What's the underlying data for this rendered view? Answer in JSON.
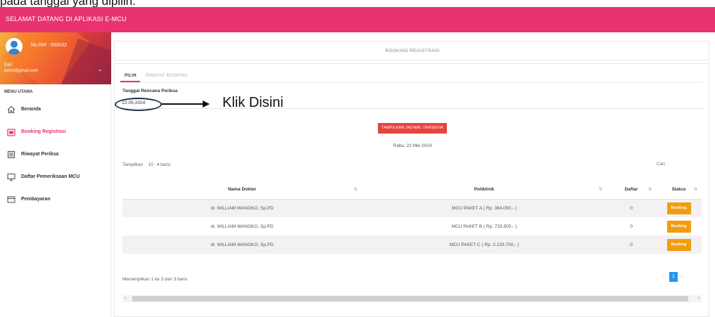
{
  "caption": "pada tanggal yang dipilih.",
  "app": {
    "title": "SELAMAT DATANG DI APLIKASI E-MCU",
    "brand_color": "#e9336f"
  },
  "profile": {
    "rm": "No.RM : 000032",
    "name": "D&F",
    "email": "bshst@gmail.com"
  },
  "sidebar": {
    "menu_title": "MENU UTAMA",
    "items": [
      {
        "label": "Beranda",
        "icon": "home-icon",
        "active": false
      },
      {
        "label": "Booking Registrasi",
        "icon": "booking-icon",
        "active": true
      },
      {
        "label": "Riwayat Periksa",
        "icon": "history-icon",
        "active": false
      },
      {
        "label": "Daftar Pemeriksaan MCU",
        "icon": "monitor-icon",
        "active": false
      },
      {
        "label": "Pembayaran",
        "icon": "payment-icon",
        "active": false
      }
    ]
  },
  "page": {
    "header": "BOOKING REGISTRASI",
    "tabs": [
      {
        "label": "PILIH",
        "active": true
      },
      {
        "label": "RIWAYAT BOOKING",
        "active": false
      }
    ],
    "date_label": "Tanggal Rencana Periksa",
    "date_value": "22-05-2024",
    "show_button": "TAMPILKAN JADWAL TERSEDIA",
    "date_text": "Rabu, 22 Mei 2024",
    "show_entries": {
      "prefix": "Tampilkan",
      "value": "10",
      "suffix": "baris"
    },
    "search_label": "Cari :"
  },
  "table": {
    "headers": [
      "Nama Dokter",
      "Poliklinik",
      "Daftar",
      "Status"
    ],
    "rows": [
      {
        "doctor": "dr. WILLIAM WANGKO, Sp.PD",
        "poli": "MCU PAKET A ( Rp. 364.000,- )",
        "daftar": "0",
        "status": "Booking"
      },
      {
        "doctor": "dr. WILLIAM WANGKO, Sp.PD",
        "poli": "MCU PAKET B ( Rp. 733.500,- )",
        "daftar": "0",
        "status": "Booking"
      },
      {
        "doctor": "dr. WILLIAM WANGKO, Sp.PD",
        "poli": "MCU PAKET C ( Rp. 2.233.700,- )",
        "daftar": "0",
        "status": "Booking"
      }
    ]
  },
  "footer": {
    "info": "Menampilkan 1 ke 3 dari 3 baris",
    "page": "1"
  },
  "annotation": {
    "text": "Klik Disini"
  }
}
